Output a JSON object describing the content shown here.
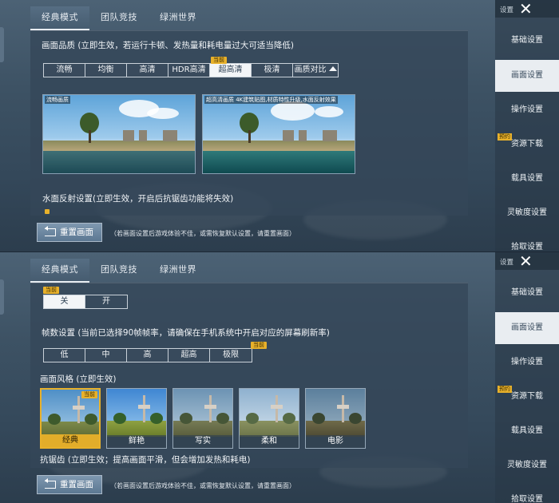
{
  "panel1": {
    "tabs": [
      "经典模式",
      "团队竞技",
      "绿洲世界"
    ],
    "quality_title": "画面品质 (立即生效，若运行卡顿、发热量和耗电量过大可适当降低)",
    "quality_options": [
      "流畅",
      "均衡",
      "高清",
      "HDR高清",
      "超高清",
      "极清",
      "画质对比"
    ],
    "current_badge": "当前",
    "preview_left_label": "流畅画质",
    "preview_right_label": "超高清画质 4K建筑贴图,材质特性升级,水面反射效果",
    "water_title": "水面反射设置(立即生效，开启后抗锯齿功能将失效)",
    "reset_label": "重置画面",
    "reset_hint": "（若画面设置后游戏体验不佳，或需恢复默认设置，请重置画面）"
  },
  "panel2": {
    "tabs": [
      "经典模式",
      "团队竞技",
      "绿洲世界"
    ],
    "current_badge": "当前",
    "switch_options": [
      "关",
      "开"
    ],
    "fps_title": "帧数设置 (当前已选择90帧帧率，请确保在手机系统中开启对应的屏幕刷新率)",
    "fps_options": [
      "低",
      "中",
      "高",
      "超高",
      "极限"
    ],
    "style_title": "画面风格 (立即生效)",
    "styles": [
      "经典",
      "鲜艳",
      "写实",
      "柔和",
      "电影"
    ],
    "aa_title": "抗锯齿 (立即生效；提高画面平滑，但会增加发热和耗电)",
    "reset_label": "重置画面",
    "reset_hint": "（若画面设置后游戏体验不佳，或需恢复默认设置，请重置画面）"
  },
  "sidebar": {
    "gear_label": "设置",
    "pre_badge": "预约",
    "items": [
      "基础设置",
      "画面设置",
      "操作设置",
      "资源下载",
      "载具设置",
      "灵敏度设置",
      "拾取设置"
    ]
  },
  "colors": {
    "accent": "#e8b12b",
    "selected": "#f3f5f7",
    "panel": "#3d5264"
  }
}
